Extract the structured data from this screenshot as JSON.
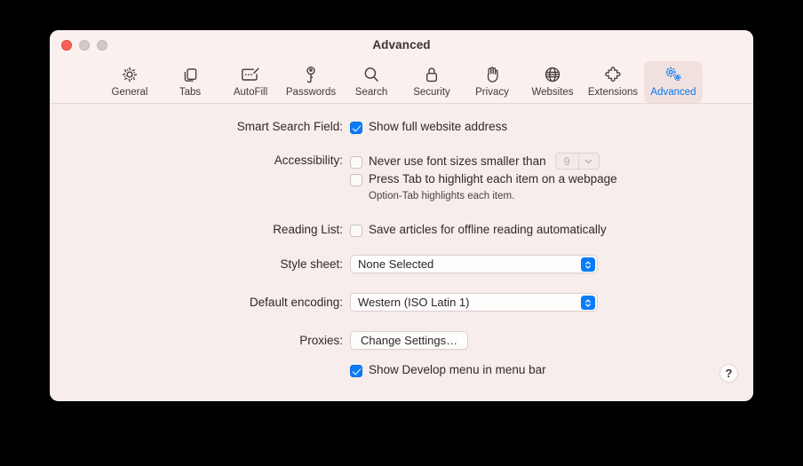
{
  "window": {
    "title": "Advanced",
    "traffic_lights": [
      {
        "name": "close",
        "color": "#fc6058"
      },
      {
        "name": "minimize",
        "color": "#d3cac8"
      },
      {
        "name": "zoom",
        "color": "#d3cac8"
      }
    ]
  },
  "toolbar": {
    "tabs": [
      {
        "label": "General",
        "icon": "gear-icon",
        "selected": false
      },
      {
        "label": "Tabs",
        "icon": "tabs-icon",
        "selected": false
      },
      {
        "label": "AutoFill",
        "icon": "autofill-icon",
        "selected": false
      },
      {
        "label": "Passwords",
        "icon": "key-icon",
        "selected": false
      },
      {
        "label": "Search",
        "icon": "search-icon",
        "selected": false
      },
      {
        "label": "Security",
        "icon": "lock-icon",
        "selected": false
      },
      {
        "label": "Privacy",
        "icon": "hand-icon",
        "selected": false
      },
      {
        "label": "Websites",
        "icon": "globe-icon",
        "selected": false
      },
      {
        "label": "Extensions",
        "icon": "puzzle-icon",
        "selected": false
      },
      {
        "label": "Advanced",
        "icon": "gears-icon",
        "selected": true
      }
    ],
    "selected_color": "#0a74f0"
  },
  "settings": {
    "smart_search_field": {
      "label": "Smart Search Field:",
      "checkbox_label": "Show full website address",
      "checked": true
    },
    "accessibility": {
      "label": "Accessibility:",
      "font_size_checkbox_label": "Never use font sizes smaller than",
      "font_size_checked": false,
      "font_size_value": "9",
      "font_size_enabled": false,
      "press_tab_checkbox_label": "Press Tab to highlight each item on a webpage",
      "press_tab_checked": false,
      "hint": "Option-Tab highlights each item."
    },
    "reading_list": {
      "label": "Reading List:",
      "checkbox_label": "Save articles for offline reading automatically",
      "checked": false
    },
    "style_sheet": {
      "label": "Style sheet:",
      "value": "None Selected"
    },
    "default_encoding": {
      "label": "Default encoding:",
      "value": "Western (ISO Latin 1)"
    },
    "proxies": {
      "label": "Proxies:",
      "button_label": "Change Settings…"
    },
    "develop_menu": {
      "checkbox_label": "Show Develop menu in menu bar",
      "checked": true
    }
  },
  "help_button": {
    "label": "?"
  },
  "colors": {
    "window_background": "#f7edeb",
    "titlebar_background": "#faf0ee",
    "accent_blue": "#0a7cf7",
    "text": "#2f2a2c",
    "selected_tab_background": "#f1e1de"
  }
}
